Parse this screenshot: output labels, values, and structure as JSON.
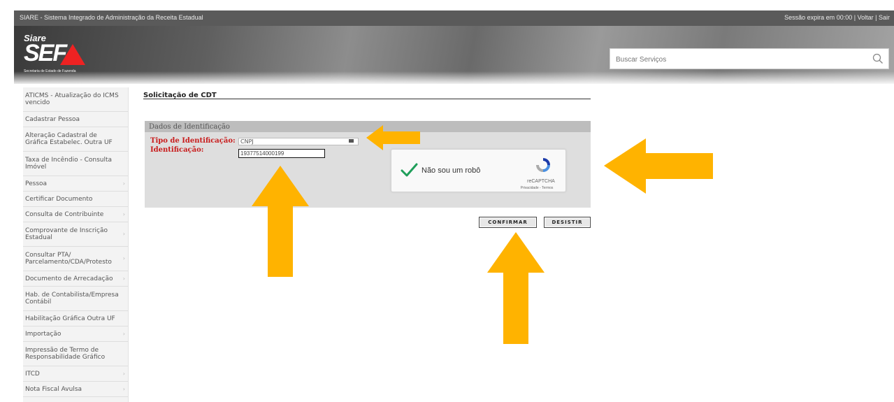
{
  "header": {
    "system_title": "SIARE - Sistema Integrado de Administração da Receita Estadual",
    "session_label": "Sessão expira em",
    "session_time": "00:00",
    "back_link": "Voltar",
    "exit_link": "Sair",
    "separator": "|"
  },
  "logo": {
    "siare": "Siare",
    "sef": "SEF",
    "subtitle": "Secretaria de Estado de Fazenda"
  },
  "search": {
    "placeholder": "Buscar Serviços",
    "icon": "search-icon"
  },
  "sidebar": {
    "items": [
      {
        "label": "ATICMS - Atualização do ICMS vencido",
        "has_submenu": false
      },
      {
        "label": "Cadastrar Pessoa",
        "has_submenu": false
      },
      {
        "label": "Alteração Cadastral de Gráfica Estabelec. Outra UF",
        "has_submenu": false
      },
      {
        "label": "Taxa de Incêndio - Consulta Imóvel",
        "has_submenu": false
      },
      {
        "label": "Pessoa",
        "has_submenu": true
      },
      {
        "label": "Certificar Documento",
        "has_submenu": false
      },
      {
        "label": "Consulta de Contribuinte",
        "has_submenu": true
      },
      {
        "label": "Comprovante de Inscrição Estadual",
        "has_submenu": true
      },
      {
        "label": "Consultar PTA/ Parcelamento/CDA/Protesto",
        "has_submenu": true
      },
      {
        "label": "Documento de Arrecadação",
        "has_submenu": true
      },
      {
        "label": "Hab. de Contabilista/Empresa Contábil",
        "has_submenu": false
      },
      {
        "label": "Habilitação Gráfica Outra UF",
        "has_submenu": false
      },
      {
        "label": "Importação",
        "has_submenu": true
      },
      {
        "label": "Impressão de Termo de Responsabilidade Gráfico",
        "has_submenu": false
      },
      {
        "label": "ITCD",
        "has_submenu": true
      },
      {
        "label": "Nota Fiscal Avulsa",
        "has_submenu": true
      }
    ]
  },
  "main": {
    "page_title": "Solicitação de CDT",
    "panel_title": "Dados de Identificação",
    "tipo_label": "Tipo de Identificação:",
    "tipo_value": "CNPJ",
    "id_label": "Identificação:",
    "id_value": "19377514000199",
    "recaptcha": {
      "text": "Não sou um robô",
      "brand": "reCAPTCHA",
      "links": "Privacidade - Termos"
    },
    "confirm_button": "CONFIRMAR",
    "cancel_button": "DESISTIR"
  },
  "colors": {
    "annotation_arrow": "#FFB300",
    "label_red": "#C81B1B",
    "recaptcha_check": "#1F9E5A"
  }
}
